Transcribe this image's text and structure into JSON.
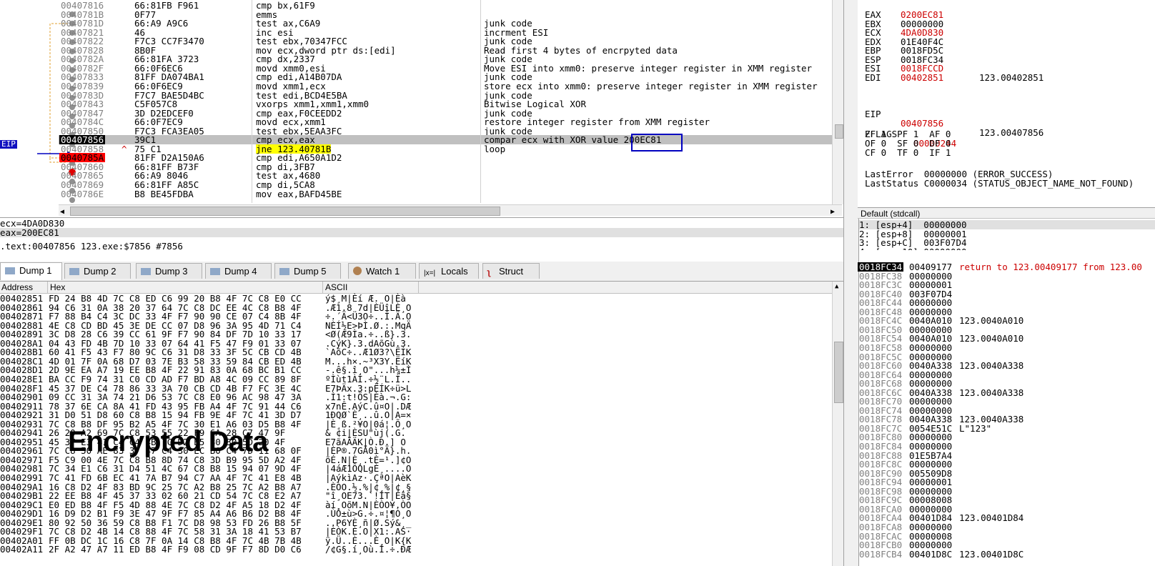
{
  "disasm": {
    "eip_label": "EIP",
    "rows": [
      {
        "addr": "00407816",
        "bytes": "66:81FB F961",
        "instr": "cmp bx,61F9",
        "cmt": ""
      },
      {
        "addr": "0040781B",
        "bytes": "0F77",
        "instr": "emms",
        "cmt": ""
      },
      {
        "addr": "0040781D",
        "bytes": "66:A9 A9C6",
        "instr": "test ax,C6A9",
        "cmt": "junk code"
      },
      {
        "addr": "00407821",
        "bytes": "46",
        "instr": "inc esi",
        "cmt": "incrment ESI"
      },
      {
        "addr": "00407822",
        "bytes": "F7C3 CC7F3470",
        "instr": "test ebx,70347FCC",
        "cmt": "junk code"
      },
      {
        "addr": "00407828",
        "bytes": "8B0F",
        "instr": "mov ecx,dword ptr ds:[edi]",
        "cmt": "Read first 4 bytes of encrpyted data"
      },
      {
        "addr": "0040782A",
        "bytes": "66:81FA 3723",
        "instr": "cmp dx,2337",
        "cmt": "junk code"
      },
      {
        "addr": "0040782F",
        "bytes": "66:0F6EC6",
        "instr": "movd xmm0,esi",
        "cmt": "Move ESI into xmm0: preserve integer register in XMM register"
      },
      {
        "addr": "00407833",
        "bytes": "81FF DA074BA1",
        "instr": "cmp edi,A14B07DA",
        "cmt": "junk code"
      },
      {
        "addr": "00407839",
        "bytes": "66:0F6EC9",
        "instr": "movd xmm1,ecx",
        "cmt": "store ecx into xmm0: preserve integer register in XMM register"
      },
      {
        "addr": "0040783D",
        "bytes": "F7C7 BAE5D4BC",
        "instr": "test edi,BCD4E5BA",
        "cmt": "junk code"
      },
      {
        "addr": "00407843",
        "bytes": "C5F057C8",
        "instr": "vxorps xmm1,xmm1,xmm0",
        "cmt": "Bitwise Logical XOR"
      },
      {
        "addr": "00407847",
        "bytes": "3D D2EDCEF0",
        "instr": "cmp eax,F0CEEDD2",
        "cmt": "junk code"
      },
      {
        "addr": "0040784C",
        "bytes": "66:0F7EC9",
        "instr": "movd ecx,xmm1",
        "cmt": "restore integer register from XMM register"
      },
      {
        "addr": "00407850",
        "bytes": "F7C3 FCA3EA05",
        "instr": "test ebx,5EAA3FC",
        "cmt": "junk code"
      },
      {
        "addr": "00407856",
        "bytes": "39C1",
        "instr": "cmp ecx,eax",
        "cmt": "compar ecx with XOR value 200EC81"
      },
      {
        "addr": "00407858",
        "bytes": "75 C1",
        "instr": "jne 123.40781B",
        "cmt": "loop"
      },
      {
        "addr": "0040785A",
        "bytes": "81FF D2A150A6",
        "instr": "cmp edi,A650A1D2",
        "cmt": ""
      },
      {
        "addr": "00407860",
        "bytes": "66:81FF B73F",
        "instr": "cmp di,3FB7",
        "cmt": ""
      },
      {
        "addr": "00407865",
        "bytes": "66:A9 8046",
        "instr": "test ax,4680",
        "cmt": ""
      },
      {
        "addr": "00407869",
        "bytes": "66:81FF A85C",
        "instr": "cmp di,5CA8",
        "cmt": ""
      },
      {
        "addr": "0040786E",
        "bytes": "B8 BE45FDBA",
        "instr": "mov eax,BAFD45BE",
        "cmt": ""
      }
    ]
  },
  "info": {
    "line1": "ecx=4DA0D830",
    "line2": "eax=200EC81",
    "line3": ".text:00407856 123.exe:$7856 #7856"
  },
  "tabs": [
    "Dump 1",
    "Dump 2",
    "Dump 3",
    "Dump 4",
    "Dump 5",
    "Watch 1",
    "Locals",
    "Struct"
  ],
  "dump": {
    "headers": {
      "address": "Address",
      "hex": "Hex",
      "ascii": "ASCII"
    },
    "overlay": "Encrypted Data",
    "rows": [
      {
        "addr": "00402851",
        "hex": "FD 24 B8 4D 7C C8 ED C6 99 20 B8 4F 7C C8 E0 CC",
        "asc": "ý$¸M|Èí Æ. O|Èà"
      },
      {
        "addr": "00402861",
        "hex": "94 C6 31 0A 38 20 37 64 7C C8 DC EE 4C C8 B8 4F",
        "asc": ".Æ1.8 7d|ÈÜîLÈ¸O"
      },
      {
        "addr": "00402871",
        "hex": "F7 88 B4 C4 3C DC 33 4F F7 90 90 CE 07 C4 8B 4F",
        "asc": "÷.´Ä<Ü3O÷..Î.Ä.O"
      },
      {
        "addr": "00402881",
        "hex": "4E C8 CD BD 45 3E DE CC 07 D8 96 3A 95 4D 71 C4",
        "asc": "NÈÍ½E>ÞÌ.Ø.:.MqÄ"
      },
      {
        "addr": "00402891",
        "hex": "3C D8 28 C6 39 CC 61 9F F7 90 84 DF 7D 10 33 17",
        "asc": "<Ø(Æ9Ìa.÷..ß}.3."
      },
      {
        "addr": "004028A1",
        "hex": "04 43 FD 4B 7D 10 33 07 64 41 F5 47 F9 01 33 07",
        "asc": ".CýK}.3.dAõGù.3."
      },
      {
        "addr": "004028B1",
        "hex": "60 41 F5 43 F7 80 9C C6 31 D8 33 3F 5C CB CD 4B",
        "asc": "`AõC÷..Æ1Ø3?\\ËÍK"
      },
      {
        "addr": "004028C1",
        "hex": "4D 01 7F 0A 68 D7 03 7E B3 58 33 59 84 CB ED 4B",
        "asc": "M...h×.~³X3Y.ËíK"
      },
      {
        "addr": "004028D1",
        "hex": "2D 9E EA A7 19 EE B8 4F 22 91 83 0A 68 BC B1 CC",
        "asc": "-.ê§.î¸O\"...h¼±Ì"
      },
      {
        "addr": "004028E1",
        "hex": "BA CC F9 74 31 C0 CD AD F7 BD A8 4C 09 CC 89 8F",
        "asc": "ºÌùt1ÀÍ.÷½¨L.Ì.."
      },
      {
        "addr": "004028F1",
        "hex": "45 37 DE C4 78 86 33 3A 70 CB CD 4B F7 FC 3E 4C",
        "asc": "E7ÞÄx.3:pËÍK÷ü>L"
      },
      {
        "addr": "00402901",
        "hex": "09 CC 31 3A 74 21 D6 53 7C C8 E0 96 AC 98 47 3A",
        "asc": ".Ì1:t!ÖS|Èà.¬.G:"
      },
      {
        "addr": "00402911",
        "hex": "78 37 6E CA 8A 41 FD 43 95 FB A4 4F 7C 91 44 C6",
        "asc": "x7nÊ.AýC.û¤O|.DÆ"
      },
      {
        "addr": "00402921",
        "hex": "31 D0 51 D8 60 C8 B8 15 94 FB 9E 4F 7C 41 3D D7",
        "asc": "1ÐQØ`È¸..û.O|A=×"
      },
      {
        "addr": "00402931",
        "hex": "7C C8 B8 DF 95 B2 A5 4F 7C 30 E1 A6 03 D5 B8 4F",
        "asc": "|È¸ß.²¥O|0á¦.Õ¸O"
      },
      {
        "addr": "00402941",
        "hex": "26 20 A2 69 7C C8 53 55 22 F9 6A 28 C7 47 9F",
        "asc": "& ¢i|ÈSU\"ùj(.G."
      },
      {
        "addr": "00402951",
        "hex": "45 37 E3 41 C4 C4 4B 7C D2 B5 80 30 5D 20 4F",
        "asc": "E7ãAÄÄK|Ò.Ð.] O"
      },
      {
        "addr": "00402961",
        "hex": "7C C8 50 AE 83 37 47 C4 30 EC B0 C4 7D 11 68 0F",
        "asc": "|ÈP®.7GÄ0ì°Ä}.h."
      },
      {
        "addr": "00402971",
        "hex": "F5 C9 00 4E 7C C8 B8 8D 74 C8 3D B9 95 5D A2 4F",
        "asc": "õÉ.N|È¸.tÈ=¹.]¢O"
      },
      {
        "addr": "00402981",
        "hex": "7C 34 E1 C6 31 D4 51 4C 67 C8 B8 15 94 07 9D 4F",
        "asc": "|4áÆ1ÔQLgÈ¸....O"
      },
      {
        "addr": "00402991",
        "hex": "7C 41 FD 6B EC 41 7A B7 94 C7 AA 4F 7C 41 E8 4B",
        "asc": "|AýkìAz·.ÇªO|AèK"
      },
      {
        "addr": "004029A1",
        "hex": "16 C8 D2 4F 83 BD 9C 25 7C A2 B8 25 7C A2 B8 A7",
        "asc": ".ÈÒO.½.%|¢¸%|¢¸§"
      },
      {
        "addr": "004029B1",
        "hex": "22 EE B8 4F 45 37 33 02 60 21 CD 54 7C C8 E2 A7",
        "asc": "\"î¸OE73.`!ÍT|Èâ§"
      },
      {
        "addr": "004029C1",
        "hex": "E0 ED B8 4F F5 4D 88 4E 7C C8 D2 4F A5 18 D2 4F",
        "asc": "àí¸OõM.N|ÈÒO¥.ÒO"
      },
      {
        "addr": "004029D1",
        "hex": "16 D9 D2 B1 F9 3E 47 9F F7 85 A4 A6 B6 D2 B8 4F",
        "asc": ".ÙÒ±ù>G.÷.¤¦¶Ò¸O"
      },
      {
        "addr": "004029E1",
        "hex": "80 92 50 36 59 C8 B8 F1 7C D8 98 53 FD 26 B8 5F",
        "asc": "..P6YÈ¸ñ|Ø.Sý&¸_"
      },
      {
        "addr": "004029F1",
        "hex": "7C C8 D2 4B 14 C8 88 4F 7C 58 31 3A 18 41 53 B7",
        "asc": "|ÈÒK.È.O|X1:.AS·"
      },
      {
        "addr": "00402A01",
        "hex": "FF 0B DC 1C 16 C8 7F 0A 14 C8 B8 4F 7C 4B 7B 4B",
        "asc": "ÿ.Ü..È...È¸O|K{K"
      },
      {
        "addr": "00402A11",
        "hex": "2F A2 47 A7 11 ED B8 4F F9 08 CD 9F F7 8D D0 C6",
        "asc": "/¢G§.í¸Où.Í.÷.ÐÆ"
      }
    ]
  },
  "regs": {
    "rows": [
      {
        "name": "EAX",
        "val": "0200EC81",
        "red": true,
        "note": ""
      },
      {
        "name": "EBX",
        "val": "00000000",
        "red": false,
        "note": ""
      },
      {
        "name": "ECX",
        "val": "4DA0D830",
        "red": true,
        "note": ""
      },
      {
        "name": "EDX",
        "val": "01E40F4C",
        "red": false,
        "note": ""
      },
      {
        "name": "EBP",
        "val": "0018FD5C",
        "red": false,
        "note": ""
      },
      {
        "name": "ESP",
        "val": "0018FC34",
        "red": false,
        "note": ""
      },
      {
        "name": "ESI",
        "val": "0018FCCD",
        "red": true,
        "note": ""
      },
      {
        "name": "EDI",
        "val": "00402851",
        "red": true,
        "note": "123.00402851"
      }
    ],
    "eip_name": "EIP",
    "eip_val": "00407856",
    "eip_note": "123.00407856",
    "eflags_name": "EFLAGS",
    "eflags_val": "00000244",
    "flags1": "ZF 1  PF 1  AF 0",
    "flags2": "OF 0  SF 0  DF 0",
    "flags3": "CF 0  TF 0  IF 1",
    "lasterror": "LastError  00000000 (ERROR_SUCCESS)",
    "laststatus": "LastStatus C0000034 (STATUS_OBJECT_NAME_NOT_FOUND)"
  },
  "args": {
    "title": "Default (stdcall)",
    "rows": [
      "1: [esp+4]  00000000",
      "2: [esp+8]  00000001",
      "3: [esp+C]  003F07D4",
      "4: [esp+10] 00000000"
    ]
  },
  "stack": {
    "rows": [
      {
        "addr": "0018FC34",
        "val": "00409177",
        "cmt": "return to 123.00409177 from 123.00",
        "top": true
      },
      {
        "addr": "0018FC38",
        "val": "00000000",
        "cmt": ""
      },
      {
        "addr": "0018FC3C",
        "val": "00000001",
        "cmt": ""
      },
      {
        "addr": "0018FC40",
        "val": "003F07D4",
        "cmt": ""
      },
      {
        "addr": "0018FC44",
        "val": "00000000",
        "cmt": ""
      },
      {
        "addr": "0018FC48",
        "val": "00000000",
        "cmt": ""
      },
      {
        "addr": "0018FC4C",
        "val": "0040A010",
        "cmt": "123.0040A010"
      },
      {
        "addr": "0018FC50",
        "val": "00000000",
        "cmt": ""
      },
      {
        "addr": "0018FC54",
        "val": "0040A010",
        "cmt": "123.0040A010"
      },
      {
        "addr": "0018FC58",
        "val": "00000000",
        "cmt": ""
      },
      {
        "addr": "0018FC5C",
        "val": "00000000",
        "cmt": ""
      },
      {
        "addr": "0018FC60",
        "val": "0040A338",
        "cmt": "123.0040A338"
      },
      {
        "addr": "0018FC64",
        "val": "00000000",
        "cmt": ""
      },
      {
        "addr": "0018FC68",
        "val": "00000000",
        "cmt": ""
      },
      {
        "addr": "0018FC6C",
        "val": "0040A338",
        "cmt": "123.0040A338"
      },
      {
        "addr": "0018FC70",
        "val": "00000000",
        "cmt": ""
      },
      {
        "addr": "0018FC74",
        "val": "00000000",
        "cmt": ""
      },
      {
        "addr": "0018FC78",
        "val": "0040A338",
        "cmt": "123.0040A338"
      },
      {
        "addr": "0018FC7C",
        "val": "0054E51C",
        "cmt": "L\"123\""
      },
      {
        "addr": "0018FC80",
        "val": "00000000",
        "cmt": ""
      },
      {
        "addr": "0018FC84",
        "val": "00000000",
        "cmt": ""
      },
      {
        "addr": "0018FC88",
        "val": "01E5B7A4",
        "cmt": ""
      },
      {
        "addr": "0018FC8C",
        "val": "00000000",
        "cmt": ""
      },
      {
        "addr": "0018FC90",
        "val": "005509D8",
        "cmt": ""
      },
      {
        "addr": "0018FC94",
        "val": "00000001",
        "cmt": ""
      },
      {
        "addr": "0018FC98",
        "val": "00000000",
        "cmt": ""
      },
      {
        "addr": "0018FC9C",
        "val": "00008008",
        "cmt": ""
      },
      {
        "addr": "0018FCA0",
        "val": "00000000",
        "cmt": ""
      },
      {
        "addr": "0018FCA4",
        "val": "00401D84",
        "cmt": "123.00401D84"
      },
      {
        "addr": "0018FCA8",
        "val": "00000000",
        "cmt": ""
      },
      {
        "addr": "0018FCAC",
        "val": "00000008",
        "cmt": ""
      },
      {
        "addr": "0018FCB0",
        "val": "00000000",
        "cmt": ""
      },
      {
        "addr": "0018FCB4",
        "val": "00401D8C",
        "cmt": "123.00401D8C"
      }
    ]
  },
  "colors": {
    "red": "#cc0000",
    "highlight": "#c0c0c0",
    "box": "#0000c0",
    "jne_bg": "#ffff00"
  }
}
